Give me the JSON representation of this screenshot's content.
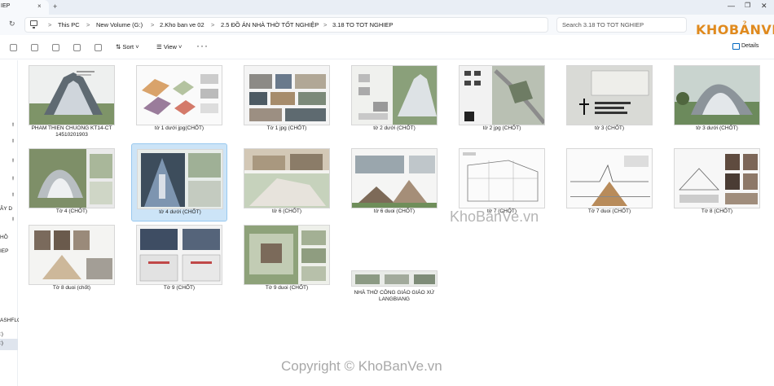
{
  "tab": {
    "label": "IEP",
    "close": "×",
    "new": "+"
  },
  "window": {
    "minimize": "—",
    "maximize": "❐",
    "close": "✕"
  },
  "nav_controls": {
    "refresh": "↻"
  },
  "breadcrumbs": [
    "This PC",
    "New Volume (G:)",
    "2.Kho ban ve 02",
    "2.5 ĐỒ ÁN NHÀ THỜ TỐT NGHIỆP",
    "3.18 TO TOT NGHIEP"
  ],
  "breadcrumb_sep": ">",
  "search": {
    "placeholder": "Search 3.18 TO TOT NGHIEP"
  },
  "toolbar": {
    "sort_label": "Sort",
    "view_label": "View",
    "more_label": "···",
    "details_label": "Details"
  },
  "sidebar": {
    "labels": [
      "ÂY D",
      "HỒ",
      "IEP",
      "ASHFLC",
      ":)",
      ":)"
    ]
  },
  "files": [
    {
      "name": "PHAM THIEN CHUONG KT14-CT 14510201903",
      "thumb": "church-cover"
    },
    {
      "name": "tờ 1 dưới jpg(CHỐT)",
      "thumb": "diagrams"
    },
    {
      "name": "Tờ 1 jpg (CHỐT)",
      "thumb": "photos"
    },
    {
      "name": "tờ 2 dưới (CHỐT)",
      "thumb": "render-site"
    },
    {
      "name": "tờ 2 jpg (CHỐT)",
      "thumb": "site-plan"
    },
    {
      "name": "tờ 3 (CHỐT)",
      "thumb": "title-sheet"
    },
    {
      "name": "tờ 3 dưới (CHỐT)",
      "thumb": "render"
    },
    {
      "name": "Tờ 4 (CHỐT)",
      "thumb": "aerial"
    },
    {
      "name": "tờ 4 dưới (CHỐT)",
      "thumb": "interior"
    },
    {
      "name": "tờ 6 (CHỐT)",
      "thumb": "site-elev"
    },
    {
      "name": "tờ 6 duoi (CHỐT)",
      "thumb": "elevation"
    },
    {
      "name": "tờ 7 (CHỐT)",
      "thumb": "plan"
    },
    {
      "name": "Tờ 7 duoi (CHỐT)",
      "thumb": "section"
    },
    {
      "name": "Tờ 8 (CHỐT)",
      "thumb": "detail"
    },
    {
      "name": "Tờ 8 duoi (chốt)",
      "thumb": "facade"
    },
    {
      "name": "Tờ 9 (CHỐT)",
      "thumb": "interior-sheets"
    },
    {
      "name": "Tờ 9 duoi (CHỐT)",
      "thumb": "landscape"
    },
    {
      "name": "NHÀ THỜ CÔNG GIÁO GIÁO XỨ LANGBIANG",
      "thumb": "banner"
    }
  ],
  "watermarks": {
    "center": "KhoBanVe.vn",
    "bottom": "Copyright © KhoBanVe.vn",
    "logo": "KHOBẢNVẼ"
  },
  "colors": {
    "accent": "#0067c0",
    "selection": "#cce4f7",
    "logo": "#e08a1e"
  }
}
